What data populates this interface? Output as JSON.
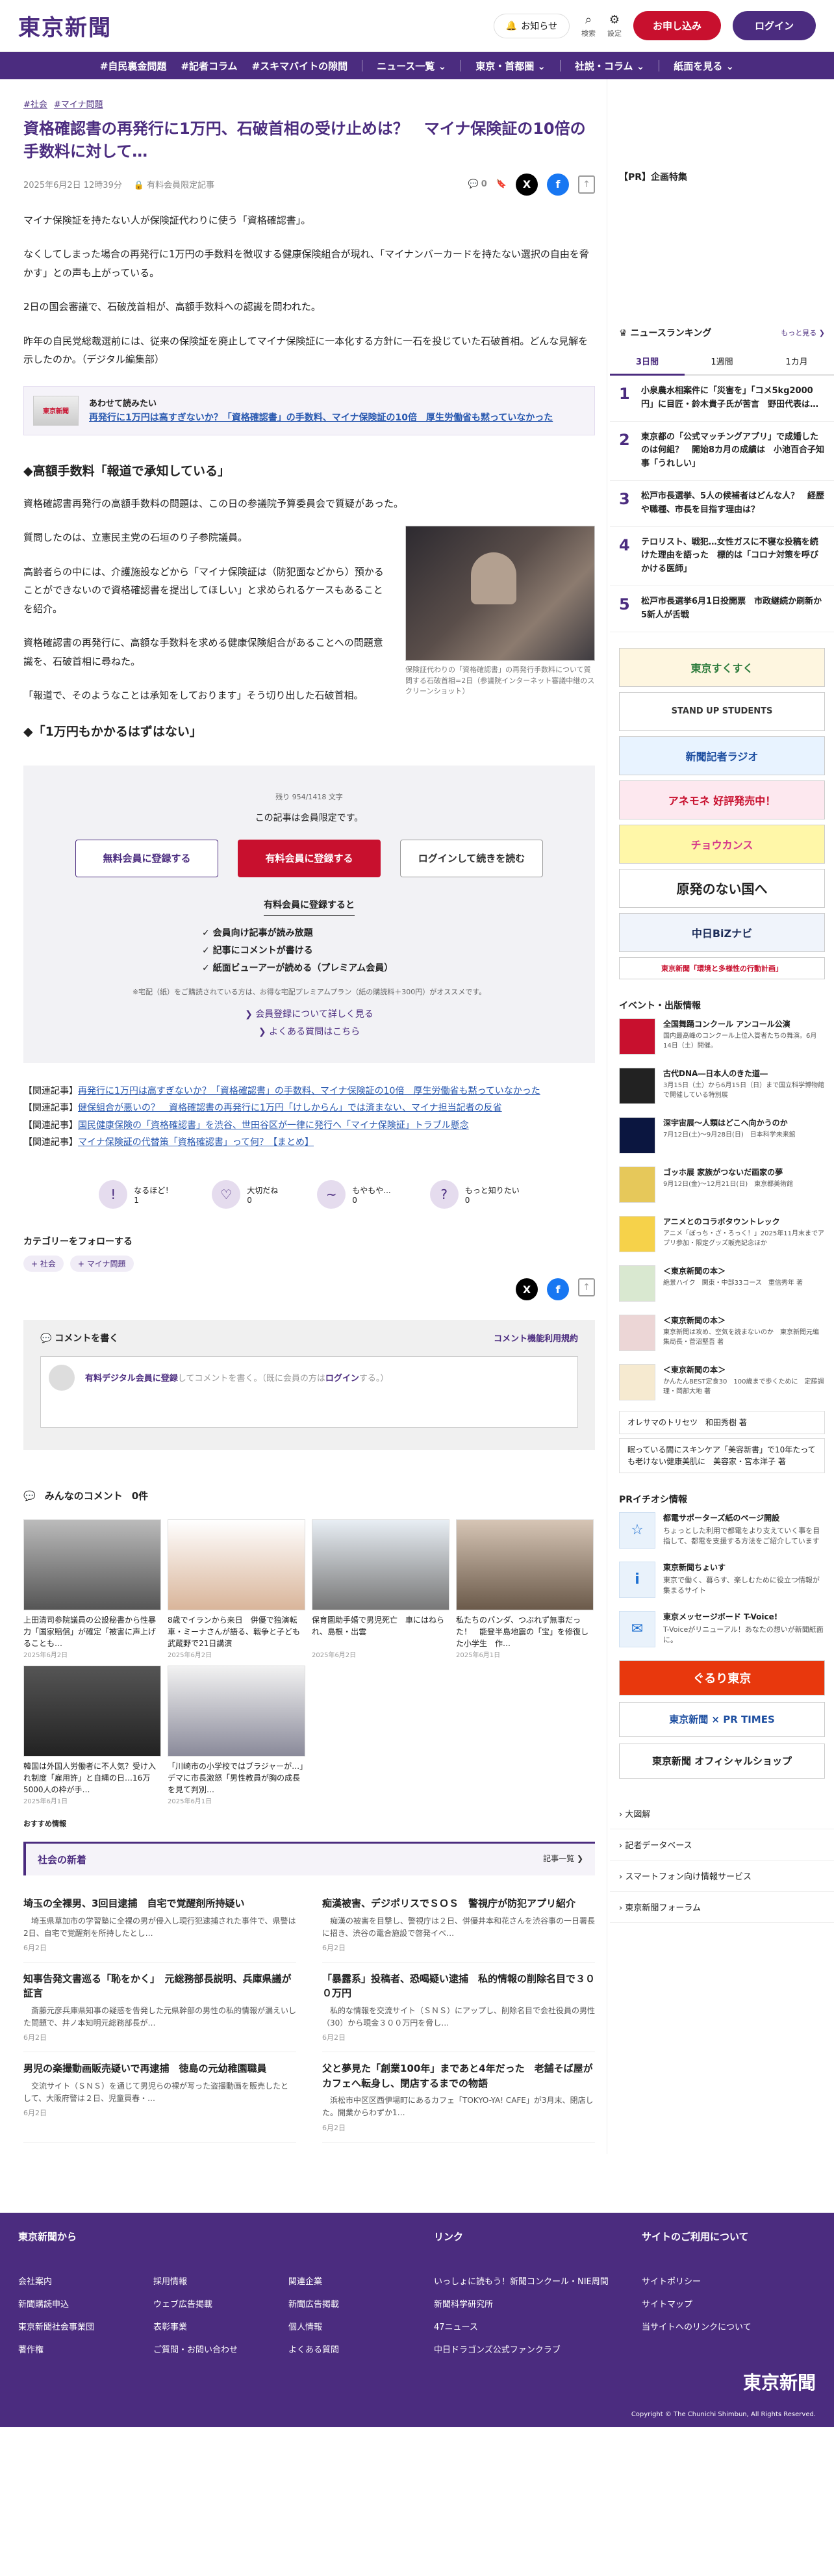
{
  "header": {
    "logo": "東京新聞",
    "notify": "お知らせ",
    "search": "検索",
    "settings": "設定",
    "subscribe": "お申し込み",
    "login": "ログイン"
  },
  "nav": [
    "#自民裏金問題",
    "#記者コラム",
    "#スキマバイトの隙間",
    "ニュース一覧 ⌄",
    "東京・首都圏 ⌄",
    "社説・コラム ⌄",
    "紙面を見る ⌄"
  ],
  "article": {
    "tags": [
      "#社会",
      "#マイナ問題"
    ],
    "title": "資格確認書の再発行に1万円、石破首相の受け止めは？　マイナ保険証の10倍の手数料に対して…",
    "date": "2025年6月2日 12時39分",
    "member": "有料会員限定記事",
    "comments": "0",
    "paragraphs": [
      "マイナ保険証を持たない人が保険証代わりに使う「資格確認書」。",
      "なくしてしまった場合の再発行に1万円の手数料を徴収する健康保険組合が現れ、「マイナンバーカードを持たない選択の自由を脅かす」との声も上がっている。",
      "2日の国会審議で、石破茂首相が、高額手数料への認識を問われた。",
      "昨年の自民党総裁選前には、従来の保険証を廃止してマイナ保険証に一本化する方針に一石を投じていた石破首相。どんな見解を示したのか。（デジタル編集部）"
    ],
    "together_label": "あわせて読みたい",
    "together_link": "再発行に1万円は高すぎないか？「資格確認書」の手数料、マイナ保険証の10倍　厚生労働省も黙っていなかった",
    "together_thumb": "東京新聞",
    "h2": "◆高額手数料「報道で承知している」",
    "paragraphs2": [
      "資格確認書再発行の高額手数料の問題は、この日の参議院予算委員会で質疑があった。",
      "質問したのは、立憲民主党の石垣のり子参院議員。",
      "高齢者らの中には、介護施設などから「マイナ保険証は（防犯面などから）預かることができないので資格確認書を提出してほしい」と求められるケースもあることを紹介。",
      "資格確認書の再発行に、高額な手数料を求める健康保険組合があることへの問題意識を、石破首相に尋ねた。",
      "「報道で、そのようなことは承知をしております」そう切り出した石破首相。"
    ],
    "h2b": "◆「1万円もかかるはずはない」",
    "image_caption": "保険証代わりの「資格確認書」の再発行手数料について質問する石破首相=2日（参議院インターネット審議中継のスクリーンショット）"
  },
  "paywall": {
    "remaining": "残り 954/1418 文字",
    "message": "この記事は会員限定です。",
    "free": "無料会員に登録する",
    "paid": "有料会員に登録する",
    "login": "ログインして続きを読む",
    "when": "有料会員に登録すると",
    "benefits": [
      "✓ 会員向け記事が読み放題",
      "✓ 記事にコメントが書ける",
      "✓ 紙面ビューアーが読める（プレミアム会員）"
    ],
    "note": "※宅配（紙）をご購読されている方は、お得な宅配プレミアムプラン（紙の購読料＋300円）がオススメです。",
    "link1": "❯ 会員登録について詳しく見る",
    "link2": "❯ よくある質問はこちら"
  },
  "related": [
    {
      "prefix": "【関連記事】",
      "text": "再発行に1万円は高すぎないか？「資格確認書」の手数料、マイナ保険証の10倍　厚生労働省も黙っていなかった"
    },
    {
      "prefix": "【関連記事】",
      "text": "健保組合が悪いの？　資格確認書の再発行に1万円「けしからん」では済まない、マイナ担当記者の反省"
    },
    {
      "prefix": "【関連記事】",
      "text": "国民健康保険の「資格確認書」を渋谷、世田谷区が一律に発行へ「マイナ保険証」トラブル懸念"
    },
    {
      "prefix": "【関連記事】",
      "text": "マイナ保険証の代替策「資格確認書」って何？【まとめ】"
    }
  ],
  "reactions": [
    {
      "icon": "!",
      "label": "なるほど！",
      "count": "1"
    },
    {
      "icon": "♡",
      "label": "大切だね",
      "count": "0"
    },
    {
      "icon": "~",
      "label": "もやもや...",
      "count": "0"
    },
    {
      "icon": "?",
      "label": "もっと知りたい",
      "count": "0"
    }
  ],
  "follow": {
    "title": "カテゴリーをフォローする",
    "chips": [
      "+ 社会",
      "+ マイナ問題"
    ]
  },
  "comment": {
    "title": "💬 コメントを書く",
    "rule": "コメント機能利用規約",
    "prompt_bold": "有料デジタル会員に登録",
    "prompt_rest": "してコメントを書く。（既に会員の方は",
    "prompt_login": "ログイン",
    "prompt_end": "する。）",
    "all": "みんなのコメント",
    "count": "0件"
  },
  "cards": [
    {
      "cap": "上田清司参院議員の公設秘書から性暴力「国家賠償」が確定「被害に声上げることも…",
      "dt": "2025年6月2日"
    },
    {
      "cap": "8歳でイランから来日　併優で独演転車・ミーナさんが語る、戦争と子ども　武蔵野で21日講演",
      "dt": "2025年6月2日"
    },
    {
      "cap": "保育園助手婚で男児死亡　車にはねられ、島根・出雲",
      "dt": "2025年6月2日"
    },
    {
      "cap": "私たちのパンダ、つぶれず無事だった！　能登半島地震の「宝」を修復した小学生　作…",
      "dt": "2025年6月1日"
    },
    {
      "cap": "韓国は外国人労働者に不人気？受け入れ制度「雇用許」と自縄の日…16万5000人の枠が手…",
      "dt": "2025年6月1日"
    },
    {
      "cap": "「川崎市の小学校ではブラジャーが…」　デマに市長激怒「男性教員が胸の成長を見て判別…",
      "dt": "2025年6月1日"
    }
  ],
  "recommend": "おすすめ情報",
  "social": {
    "title": "社会の新着",
    "more": "記事一覧 ❯",
    "items": [
      {
        "t": "埼玉の全裸男、3回目逮捕　自宅で覚醒剤所持疑い",
        "x": "　埼玉県草加市の学習塾に全裸の男が侵入し現行犯逮捕された事件で、県警は2日、自宅で覚醒剤を所持したとし…",
        "d": "6月2日"
      },
      {
        "t": "痴漢被害、デジポリスでＳＯＳ　警視庁が防犯アプリ紹介",
        "x": "　痴漢の被害を目撃し、警視庁は２日、併優井本和花さんを渋谷事の一日署長に招き、渋谷の電合施設で啓発イベ…",
        "d": "6月2日"
      },
      {
        "t": "知事告発文書巡る「恥をかく」　元総務部長説明、兵庫県議が証言",
        "x": "　斎藤元彦兵庫県知事の疑惑を告発した元県幹部の男性の私的情報が漏えいした問題で、井ノ本知明元総務部長が…",
        "d": "6月2日"
      },
      {
        "t": "「暴露系」投稿者、恐喝疑い逮捕　私的情報の削除名目で３００万円",
        "x": "　私的な情報を交流サイト（ＳＮＳ）にアップし、削除名目で会社役員の男性（30）から現金３００万円を脅し…",
        "d": "6月2日"
      },
      {
        "t": "男児の楽撮動画販売疑いで再逮捕　徳島の元幼稚園職員",
        "x": "　交流サイト（ＳＮＳ）を通じて男児らの裸が写った盗撮動画を販売したとして、大阪府警は２日、児童買春・…",
        "d": "6月2日"
      },
      {
        "t": "父と夢見た「創業100年」まであと4年だった　老舗そば屋がカフェへ転身し、閉店するまでの物語",
        "x": "　浜松市中区区西伊場町にあるカフェ「TOKYO-YA! CAFE」が3月末、閉店した。開業からわずか1…",
        "d": "6月2日"
      }
    ]
  },
  "sidebar": {
    "pr": "【PR】企画特集",
    "ranking": "ニュースランキング",
    "more": "もっと見る ❯",
    "tabs": [
      "3日間",
      "1週間",
      "1カ月"
    ],
    "ranks": [
      {
        "n": "1",
        "t": "小泉農水相案件に「災害を」「コメ5kg2000円」に目匠・鈴木貴子氏が苦言　野田代表は…"
      },
      {
        "n": "2",
        "t": "東京都の「公式マッチングアプリ」で成婚したのは何組？　開始8カ月の成績は　小池百合子知事「うれしい」"
      },
      {
        "n": "3",
        "t": "松戸市長選挙、5人の候補者はどんな人？　経歴や職種、市長を目指す理由は？"
      },
      {
        "n": "4",
        "t": "テロリスト、戦犯…女性ガスに不寝な投稿を続けた理由を語った　標的は「コロナ対策を呼びかける医師」"
      },
      {
        "n": "5",
        "t": "松戸市長選挙6月1日投開票　市政継続か刷新か　5新人が舌戦"
      }
    ],
    "banners": [
      "東京すくすく",
      "STAND UP STUDENTS",
      "新聞記者ラジオ",
      "アネモネ 好評発売中！",
      "チョウカンス",
      "原発のない国へ",
      "中日BiZナビ",
      "東京新聞「環境と多様性の行動計画」"
    ],
    "events_title": "イベント・出版情報",
    "events": [
      {
        "t": "全国舞踊コンクール アンコール公演",
        "d": "国内最高峰のコンクール上位入賞者たちの舞演。6月14日（土）開催。"
      },
      {
        "t": "古代DNA―日本人のきた道―",
        "d": "3月15日（土）から6月15日（日）まで国立科学博物館で開催している特別展"
      },
      {
        "t": "深宇宙展～人類はどこへ向かうのか",
        "d": "7月12日(土)～9月28日(日)　日本科学未来館"
      },
      {
        "t": "ゴッホ展 家族がつないだ画家の夢",
        "d": "9月12日(金)～12月21日(日)　東京都美術館"
      },
      {
        "t": "アニメとのコラボタウントレック",
        "d": "アニメ「ぼっち・ざ・ろっく！」2025年11月末までアプリ参加・限定グッズ販売記念ほか"
      },
      {
        "t": "＜東京新聞の本＞",
        "d": "絶景ハイク　関東・中部33コース　重信秀年 著"
      },
      {
        "t": "＜東京新聞の本＞",
        "d": "東京新聞は攻め、空気を読まないのか　東京新聞元編集局長・菅沼堅吾 著"
      },
      {
        "t": "＜東京新聞の本＞",
        "d": "かんたんBEST定食30　100歳まで歩くために　定藤調理・岡部大地 著"
      }
    ],
    "box1": "オレサマのトリセツ　和田秀樹 著",
    "box2": "眠っている間にスキンケア「美容新書」で10年たっても老けない健康美肌に　美容家・宮本洋子 著",
    "pri_title": "PRイチオシ情報",
    "pris": [
      {
        "i": "☆",
        "t": "都電サポーターズ紙のページ開設",
        "d": "ちょっとした利用で都電をより支えていく事を目指して、都電を支援する方法をご紹介しています"
      },
      {
        "i": "i",
        "t": "東京新聞ちょいす",
        "d": "東京で働く、暮らす、楽しむために役立つ情報が集まるサイト"
      },
      {
        "i": "✉",
        "t": "東京メッセージボード T-Voice!",
        "d": "T-Voiceがリニューアル！あなたの想いが新聞紙面に。"
      }
    ],
    "bn2": [
      "ぐるり東京",
      "東京新聞 × PR TIMES",
      "東京新聞 オフィシャルショップ"
    ],
    "links": [
      "› 大図解",
      "› 記者データベース",
      "› スマートフォン向け情報サービス",
      "› 東京新聞フォーラム"
    ]
  },
  "footer": {
    "c1": "東京新聞から",
    "c1a": [
      "会社案内",
      "新聞購読申込",
      "東京新聞社会事業団",
      "著作権"
    ],
    "c1b": [
      "採用情報",
      "ウェブ広告掲載",
      "表彰事業",
      "ご質問・お問い合わせ"
    ],
    "c1c": [
      "関連企業",
      "新聞広告掲載",
      "個人情報",
      "よくある質問"
    ],
    "c2": "リンク",
    "c2a": [
      "いっしょに読もう！新聞コンクール・NIE周間",
      "新聞科学研究所",
      "47ニュース",
      "中日ドラゴンズ公式ファンクラブ"
    ],
    "c3": "サイトのご利用について",
    "c3a": [
      "サイトポリシー",
      "サイトマップ",
      "当サイトへのリンクについて"
    ],
    "logo": "東京新聞",
    "copy": "Copyright © The Chunichi Shimbun, All Rights Reserved."
  }
}
